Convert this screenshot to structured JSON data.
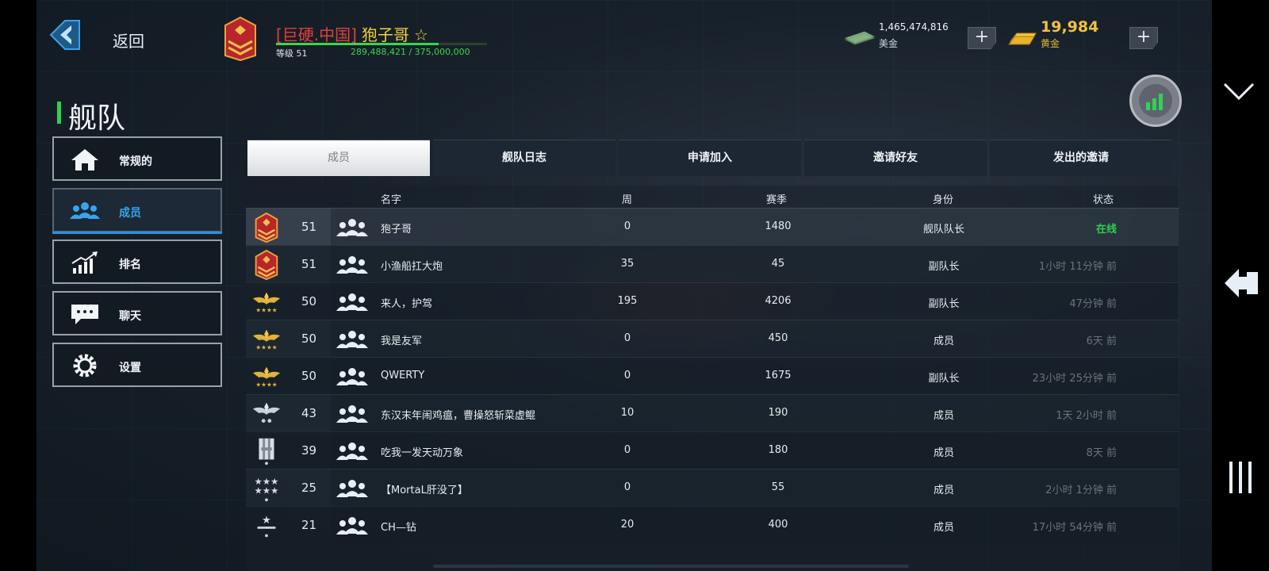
{
  "header": {
    "back_label": "返回",
    "clan_tag": "[巨硬.中国]",
    "player_name": "狍子哥",
    "level_text": "等级 51",
    "xp_text": "289,488,421 / 375,000,000",
    "xp_fraction": 0.772,
    "cash_amount": "1,465,474,816",
    "cash_label": "美金",
    "gold_amount": "19,984",
    "gold_label": "黄金",
    "plus": "+"
  },
  "page": {
    "title": "舰队"
  },
  "sidebar": {
    "items": [
      {
        "label": "常规的",
        "icon": "home-icon",
        "active": false
      },
      {
        "label": "成员",
        "icon": "members-icon",
        "active": true
      },
      {
        "label": "排名",
        "icon": "ranking-icon",
        "active": false
      },
      {
        "label": "聊天",
        "icon": "chat-icon",
        "active": false
      },
      {
        "label": "设置",
        "icon": "gear-icon",
        "active": false
      }
    ]
  },
  "tabs": [
    {
      "label": "成员",
      "active": true
    },
    {
      "label": "舰队日志",
      "active": false
    },
    {
      "label": "申请加入",
      "active": false
    },
    {
      "label": "邀请好友",
      "active": false
    },
    {
      "label": "发出的邀请",
      "active": false
    }
  ],
  "table": {
    "headers": {
      "name": "名字",
      "week": "周",
      "season": "赛季",
      "role": "身份",
      "status": "状态"
    },
    "rows": [
      {
        "rank_icon": "chevron-badge-icon",
        "level": "51",
        "name": "狍子哥",
        "week": "0",
        "season": "1480",
        "role": "舰队队长",
        "status": "在线",
        "online": true
      },
      {
        "rank_icon": "chevron-badge-icon",
        "level": "51",
        "name": "小渔船扛大炮",
        "week": "35",
        "season": "45",
        "role": "副队长",
        "status": "1小时 11分钟 前",
        "online": false
      },
      {
        "rank_icon": "gold-wings-icon",
        "level": "50",
        "name": "来人，护驾",
        "week": "195",
        "season": "4206",
        "role": "副队长",
        "status": "47分钟 前",
        "online": false
      },
      {
        "rank_icon": "gold-wings-icon",
        "level": "50",
        "name": "我是友军",
        "week": "0",
        "season": "450",
        "role": "成员",
        "status": "6天 前",
        "online": false
      },
      {
        "rank_icon": "gold-wings-icon",
        "level": "50",
        "name": "QWERTY",
        "week": "0",
        "season": "1675",
        "role": "副队长",
        "status": "23小时 25分钟 前",
        "online": false
      },
      {
        "rank_icon": "silver-wings-icon",
        "level": "43",
        "name": "东汉末年闹鸡瘟，曹操怒斩菜虚鲲",
        "week": "10",
        "season": "190",
        "role": "成员",
        "status": "1天 2小时 前",
        "online": false
      },
      {
        "rank_icon": "silver-bars-icon",
        "level": "39",
        "name": "吃我一发天动万象",
        "week": "0",
        "season": "180",
        "role": "成员",
        "status": "8天 前",
        "online": false
      },
      {
        "rank_icon": "silver-stars-icon",
        "level": "25",
        "name": "【MortaL肝没了】",
        "week": "0",
        "season": "55",
        "role": "成员",
        "status": "2小时 1分钟 前",
        "online": false
      },
      {
        "rank_icon": "silver-star-icon",
        "level": "21",
        "name": "CH—钻",
        "week": "20",
        "season": "400",
        "role": "成员",
        "status": "17小时 54分钟 前",
        "online": false
      }
    ]
  },
  "colors": {
    "accent_green": "#2ad352",
    "online_green": "#2fcf4d",
    "active_blue": "#38a4f0",
    "clan_red": "#e0403a",
    "gold": "#f1c23a"
  }
}
